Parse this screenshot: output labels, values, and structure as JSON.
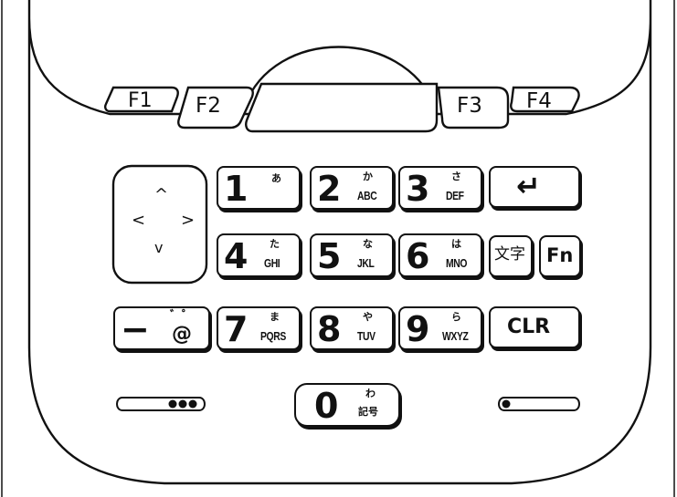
{
  "function_keys": [
    "F1",
    "F2",
    "F3",
    "F4"
  ],
  "nav": {
    "up": "^",
    "down": "v",
    "left": "<",
    "right": ">"
  },
  "keys": {
    "k1": {
      "num": "1",
      "kana": "あ",
      "alpha": ""
    },
    "k2": {
      "num": "2",
      "kana": "か",
      "alpha": "ABC"
    },
    "k3": {
      "num": "3",
      "kana": "さ",
      "alpha": "DEF"
    },
    "k4": {
      "num": "4",
      "kana": "た",
      "alpha": "GHI"
    },
    "k5": {
      "num": "5",
      "kana": "な",
      "alpha": "JKL"
    },
    "k6": {
      "num": "6",
      "kana": "は",
      "alpha": "MNO"
    },
    "k7": {
      "num": "7",
      "kana": "ま",
      "alpha": "PQRS"
    },
    "k8": {
      "num": "8",
      "kana": "や",
      "alpha": "TUV"
    },
    "k9": {
      "num": "9",
      "kana": "ら",
      "alpha": "WXYZ"
    },
    "k0": {
      "num": "0",
      "kana": "わ",
      "alpha": "記号"
    }
  },
  "symbol_key": {
    "dash": "−",
    "mark": "゛゜",
    "at": "@"
  },
  "moji_key": "文字",
  "fn_key": "Fn",
  "clr_key": "CLR",
  "enter_key": "↵",
  "colors": {
    "line": "#111111",
    "background": "#ffffff"
  }
}
